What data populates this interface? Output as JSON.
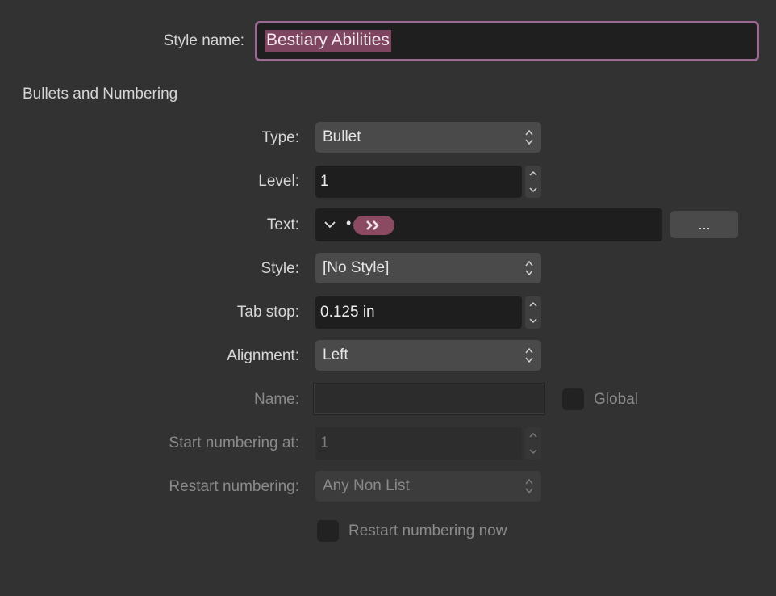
{
  "style_name": {
    "label": "Style name:",
    "value": "Bestiary Abilities"
  },
  "section": {
    "title": "Bullets and Numbering"
  },
  "type": {
    "label": "Type:",
    "value": "Bullet"
  },
  "level": {
    "label": "Level:",
    "value": "1"
  },
  "text": {
    "label": "Text:",
    "bullet_char": "•",
    "token_icon": "double-chevron-right-icon",
    "more_button": "..."
  },
  "style": {
    "label": "Style:",
    "value": "[No Style]"
  },
  "tab_stop": {
    "label": "Tab stop:",
    "value": "0.125 in"
  },
  "alignment": {
    "label": "Alignment:",
    "value": "Left"
  },
  "name": {
    "label": "Name:",
    "value": ""
  },
  "global": {
    "label": "Global",
    "checked": false
  },
  "start_numbering": {
    "label": "Start numbering at:",
    "value": "1"
  },
  "restart_numbering": {
    "label": "Restart numbering:",
    "value": "Any Non List"
  },
  "restart_now": {
    "label": "Restart numbering now",
    "checked": false
  },
  "colors": {
    "background": "#323232",
    "focus_ring": "#9b6a90",
    "selection": "#7d4560",
    "token": "#8a4a62"
  }
}
